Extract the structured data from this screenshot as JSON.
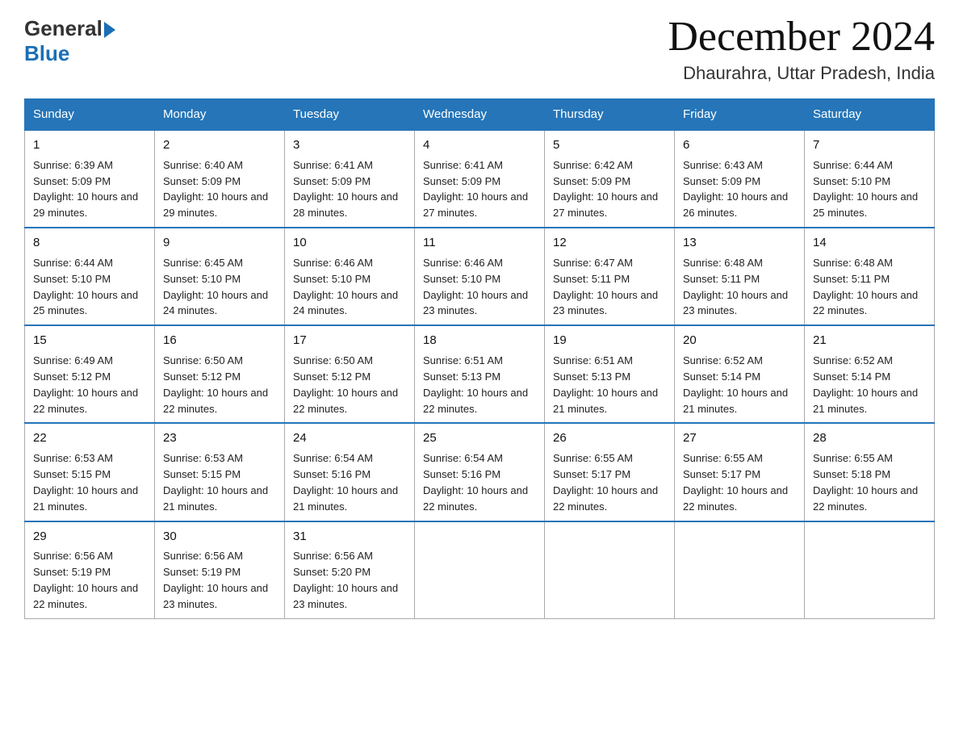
{
  "header": {
    "logo_general": "General",
    "logo_blue": "Blue",
    "month_year": "December 2024",
    "location": "Dhaurahra, Uttar Pradesh, India"
  },
  "weekdays": [
    "Sunday",
    "Monday",
    "Tuesday",
    "Wednesday",
    "Thursday",
    "Friday",
    "Saturday"
  ],
  "weeks": [
    [
      {
        "day": "1",
        "sunrise": "6:39 AM",
        "sunset": "5:09 PM",
        "daylight": "10 hours and 29 minutes."
      },
      {
        "day": "2",
        "sunrise": "6:40 AM",
        "sunset": "5:09 PM",
        "daylight": "10 hours and 29 minutes."
      },
      {
        "day": "3",
        "sunrise": "6:41 AM",
        "sunset": "5:09 PM",
        "daylight": "10 hours and 28 minutes."
      },
      {
        "day": "4",
        "sunrise": "6:41 AM",
        "sunset": "5:09 PM",
        "daylight": "10 hours and 27 minutes."
      },
      {
        "day": "5",
        "sunrise": "6:42 AM",
        "sunset": "5:09 PM",
        "daylight": "10 hours and 27 minutes."
      },
      {
        "day": "6",
        "sunrise": "6:43 AM",
        "sunset": "5:09 PM",
        "daylight": "10 hours and 26 minutes."
      },
      {
        "day": "7",
        "sunrise": "6:44 AM",
        "sunset": "5:10 PM",
        "daylight": "10 hours and 25 minutes."
      }
    ],
    [
      {
        "day": "8",
        "sunrise": "6:44 AM",
        "sunset": "5:10 PM",
        "daylight": "10 hours and 25 minutes."
      },
      {
        "day": "9",
        "sunrise": "6:45 AM",
        "sunset": "5:10 PM",
        "daylight": "10 hours and 24 minutes."
      },
      {
        "day": "10",
        "sunrise": "6:46 AM",
        "sunset": "5:10 PM",
        "daylight": "10 hours and 24 minutes."
      },
      {
        "day": "11",
        "sunrise": "6:46 AM",
        "sunset": "5:10 PM",
        "daylight": "10 hours and 23 minutes."
      },
      {
        "day": "12",
        "sunrise": "6:47 AM",
        "sunset": "5:11 PM",
        "daylight": "10 hours and 23 minutes."
      },
      {
        "day": "13",
        "sunrise": "6:48 AM",
        "sunset": "5:11 PM",
        "daylight": "10 hours and 23 minutes."
      },
      {
        "day": "14",
        "sunrise": "6:48 AM",
        "sunset": "5:11 PM",
        "daylight": "10 hours and 22 minutes."
      }
    ],
    [
      {
        "day": "15",
        "sunrise": "6:49 AM",
        "sunset": "5:12 PM",
        "daylight": "10 hours and 22 minutes."
      },
      {
        "day": "16",
        "sunrise": "6:50 AM",
        "sunset": "5:12 PM",
        "daylight": "10 hours and 22 minutes."
      },
      {
        "day": "17",
        "sunrise": "6:50 AM",
        "sunset": "5:12 PM",
        "daylight": "10 hours and 22 minutes."
      },
      {
        "day": "18",
        "sunrise": "6:51 AM",
        "sunset": "5:13 PM",
        "daylight": "10 hours and 22 minutes."
      },
      {
        "day": "19",
        "sunrise": "6:51 AM",
        "sunset": "5:13 PM",
        "daylight": "10 hours and 21 minutes."
      },
      {
        "day": "20",
        "sunrise": "6:52 AM",
        "sunset": "5:14 PM",
        "daylight": "10 hours and 21 minutes."
      },
      {
        "day": "21",
        "sunrise": "6:52 AM",
        "sunset": "5:14 PM",
        "daylight": "10 hours and 21 minutes."
      }
    ],
    [
      {
        "day": "22",
        "sunrise": "6:53 AM",
        "sunset": "5:15 PM",
        "daylight": "10 hours and 21 minutes."
      },
      {
        "day": "23",
        "sunrise": "6:53 AM",
        "sunset": "5:15 PM",
        "daylight": "10 hours and 21 minutes."
      },
      {
        "day": "24",
        "sunrise": "6:54 AM",
        "sunset": "5:16 PM",
        "daylight": "10 hours and 21 minutes."
      },
      {
        "day": "25",
        "sunrise": "6:54 AM",
        "sunset": "5:16 PM",
        "daylight": "10 hours and 22 minutes."
      },
      {
        "day": "26",
        "sunrise": "6:55 AM",
        "sunset": "5:17 PM",
        "daylight": "10 hours and 22 minutes."
      },
      {
        "day": "27",
        "sunrise": "6:55 AM",
        "sunset": "5:17 PM",
        "daylight": "10 hours and 22 minutes."
      },
      {
        "day": "28",
        "sunrise": "6:55 AM",
        "sunset": "5:18 PM",
        "daylight": "10 hours and 22 minutes."
      }
    ],
    [
      {
        "day": "29",
        "sunrise": "6:56 AM",
        "sunset": "5:19 PM",
        "daylight": "10 hours and 22 minutes."
      },
      {
        "day": "30",
        "sunrise": "6:56 AM",
        "sunset": "5:19 PM",
        "daylight": "10 hours and 23 minutes."
      },
      {
        "day": "31",
        "sunrise": "6:56 AM",
        "sunset": "5:20 PM",
        "daylight": "10 hours and 23 minutes."
      },
      null,
      null,
      null,
      null
    ]
  ],
  "labels": {
    "sunrise_prefix": "Sunrise: ",
    "sunset_prefix": "Sunset: ",
    "daylight_prefix": "Daylight: "
  }
}
